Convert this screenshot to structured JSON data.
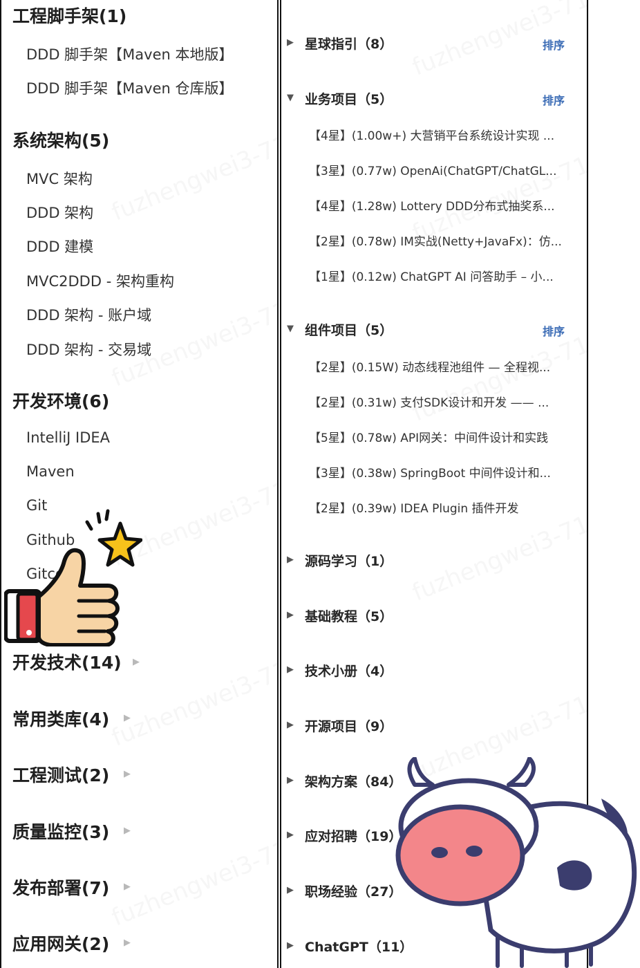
{
  "left": {
    "cat_scaffold": {
      "title": "工程脚手架(1)",
      "items": [
        "DDD 脚手架【Maven 本地版】",
        "DDD 脚手架【Maven 仓库版】"
      ]
    },
    "cat_arch": {
      "title": "系统架构(5)",
      "items": [
        "MVC 架构",
        "DDD 架构",
        "DDD 建模",
        "MVC2DDD - 架构重构",
        "DDD 架构 - 账户域",
        "DDD 架构 - 交易域"
      ]
    },
    "cat_env": {
      "title": "开发环境(6)",
      "items": [
        "IntelliJ IDEA",
        "Maven",
        "Git",
        "Github",
        "Gitcode"
      ]
    },
    "collapsed": [
      "开发技术(14)",
      "常用类库(4)",
      "工程测试(2)",
      "质量监控(3)",
      "发布部署(7)",
      "应用网关(2)"
    ],
    "arrow_glyph": "▶"
  },
  "right": {
    "sort_label": "排序",
    "arrow_collapsed": "▶",
    "arrow_expanded": "▼",
    "group_guide": {
      "title": "星球指引（8）"
    },
    "group_business": {
      "title": "业务项目（5）",
      "items": [
        "【4星】(1.00w+) 大营销平台系统设计实现 ...",
        "【3星】(0.77w) OpenAi(ChatGPT/ChatGL...",
        "【4星】(1.28w) Lottery DDD分布式抽奖系...",
        "【2星】(0.78w) IM实战(Netty+JavaFx)：仿...",
        "【1星】(0.12w) ChatGPT AI 问答助手 – 小..."
      ]
    },
    "group_component": {
      "title": "组件项目（5）",
      "items": [
        "【2星】(0.15W) 动态线程池组件 — 全程视...",
        "【2星】(0.31w) 支付SDK设计和开发 —— ...",
        "【5星】(0.78w) API网关：中间件设计和实践",
        "【3星】(0.38w) SpringBoot 中间件设计和...",
        "【2星】(0.39w) IDEA Plugin 插件开发"
      ]
    },
    "collapsed_groups": [
      "源码学习（1）",
      "基础教程（5）",
      "技术小册（4）",
      "开源项目（9）",
      "架构方案（84）",
      "应对招聘（19）",
      "职场经验（27）",
      "ChatGPT（11）"
    ]
  },
  "colors": {
    "accent": "#3a6bb5",
    "border": "#111111",
    "star": "#f7c21b",
    "cow_nose": "#f3868a",
    "thumb_skin": "#f7d4a5",
    "cuff": "#e5484d"
  },
  "icons": [
    "thumbs-up-sticker-icon",
    "cow-sticker-icon",
    "star-icon"
  ]
}
